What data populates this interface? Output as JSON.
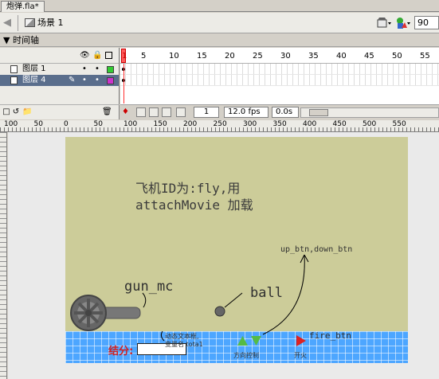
{
  "tab": {
    "title": "炮弹.fla*"
  },
  "scene": {
    "label": "场景 1"
  },
  "zoom": {
    "value": "90"
  },
  "timeline": {
    "title": "时间轴",
    "frame_numbers": [
      "1",
      "5",
      "10",
      "15",
      "20",
      "25",
      "30",
      "35",
      "40",
      "45",
      "50",
      "55"
    ],
    "layers": [
      {
        "name": "图层 1",
        "selected": false,
        "color": "#33cc33"
      },
      {
        "name": "图层 4",
        "selected": true,
        "color": "#cc33cc"
      }
    ],
    "current_frame": "1",
    "fps": "12.0 fps",
    "time": "0.0s"
  },
  "ruler": {
    "numbers": [
      "100",
      "50",
      "0",
      "50",
      "100",
      "150",
      "200",
      "250",
      "300",
      "350",
      "400",
      "450",
      "500",
      "550"
    ]
  },
  "stage": {
    "background": "#cccc99",
    "note_line1": "飞机ID为:fly,用",
    "note_line2": "attachMovie 加载",
    "gun_label": "gun_mc",
    "ball_label": "ball",
    "buttons_label": "up_btn,down_btn",
    "fire_label": "fire_btn",
    "score_label": "结分:",
    "dynamic_text_line1": "动态文本框,",
    "dynamic_text_line2": "变量名 tota1",
    "direction_label": "方向控制",
    "switch_label": "开火"
  }
}
